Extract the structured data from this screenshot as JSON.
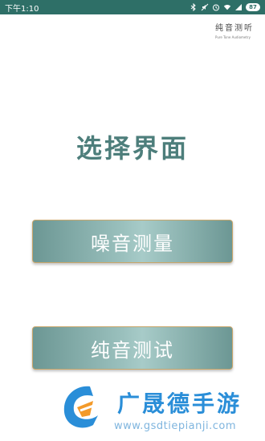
{
  "status_bar": {
    "time": "下午1:10",
    "battery": "87",
    "icons": [
      "bluetooth-icon",
      "mute-icon",
      "alarm-icon",
      "wifi-icon",
      "signal-icon",
      "battery-icon"
    ]
  },
  "brand": {
    "title": "纯音测听",
    "subtitle": "Pure Tone Audiometry"
  },
  "main": {
    "title": "选择界面",
    "buttons": [
      {
        "label": "噪音测量"
      },
      {
        "label": "纯音测试"
      }
    ]
  },
  "watermark": {
    "name": "广晟德手游",
    "url": "www.gsdtiepianji.com",
    "logo_color": "#2a8ed8",
    "logo_accent": "#f39a2a"
  },
  "colors": {
    "status_bar": "#2e6f67",
    "title": "#4d7e7b",
    "button_border": "#c8a66a",
    "button_fill": "#9ac0bd"
  }
}
